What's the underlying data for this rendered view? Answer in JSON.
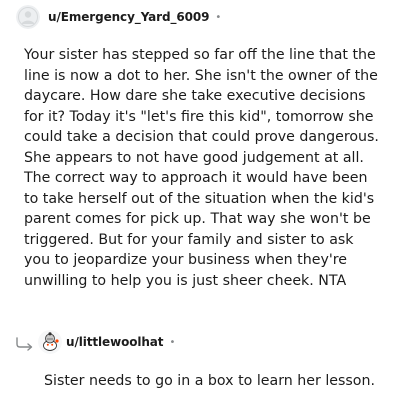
{
  "comment1": {
    "username": "u/Emergency_Yard_6009",
    "separator": "•",
    "avatar_icon": "default-avatar-icon",
    "body": "Your sister has stepped so far off the line that the line is now a dot to her. She isn't the owner of the daycare. How dare she take executive decisions for it? Today it's \"let's fire this kid\", tomorrow she could take a decision that could prove dangerous. She appears to not have good judgement at all. The correct way to approach it would have been to take herself out of the situation when the kid's parent comes for pick up. That way she won't be triggered. But for your family and sister to ask you to jeopardize your business when they're unwilling to help you is just sheer cheek. NTA"
  },
  "comment2": {
    "username": "u/littlewoolhat",
    "separator": "•",
    "avatar_icon": "snoo-avatar-icon",
    "reply_icon": "reply-arrow-icon",
    "body": "Sister needs to go in a box to learn her lesson."
  },
  "colors": {
    "text": "#1c1c1c",
    "muted": "#878a8c",
    "background": "#ffffff"
  }
}
